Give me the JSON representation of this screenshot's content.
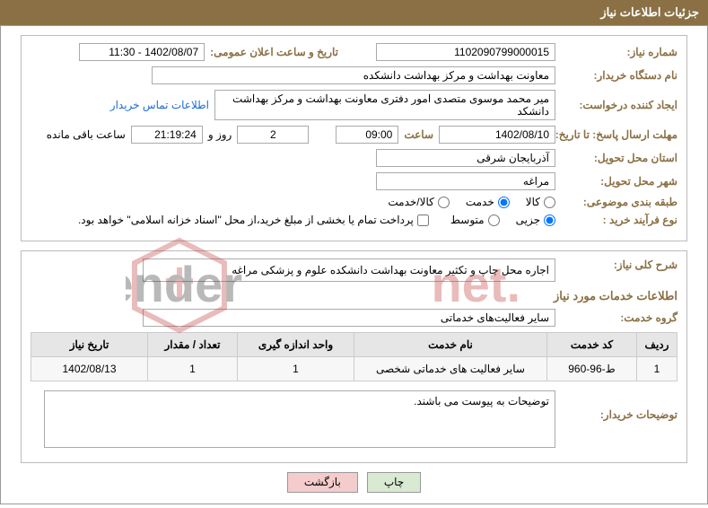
{
  "header": {
    "title": "جزئیات اطلاعات نیاز"
  },
  "fields": {
    "need_no_label": "شماره نیاز:",
    "need_no": "1102090799000015",
    "pub_date_label": "تاریخ و ساعت اعلان عمومی:",
    "pub_date": "1402/08/07 - 11:30",
    "buyer_org_label": "نام دستگاه خریدار:",
    "buyer_org": "معاونت بهداشت و مرکز بهداشت دانشکده",
    "requester_label": "ایجاد کننده درخواست:",
    "requester": "میر محمد موسوی متصدی امور دفتری معاونت بهداشت و مرکز بهداشت دانشکد",
    "contact_link": "اطلاعات تماس خریدار",
    "deadline_label": "مهلت ارسال پاسخ: تا تاریخ:",
    "deadline_date": "1402/08/10",
    "time_label": "ساعت",
    "deadline_time": "09:00",
    "days_count": "2",
    "days_and": "روز و",
    "remaining_time": "21:19:24",
    "remaining_label": "ساعت باقی مانده",
    "province_label": "استان محل تحویل:",
    "province": "آذربایجان شرقی",
    "city_label": "شهر محل تحویل:",
    "city": "مراغه",
    "subject_class_label": "طبقه بندی موضوعی:",
    "opt_goods": "کالا",
    "opt_service": "خدمت",
    "opt_goods_service": "کالا/خدمت",
    "process_label": "نوع فرآیند خرید :",
    "opt_minor": "جزیی",
    "opt_moderate": "متوسط",
    "payment_note": "پرداخت تمام یا بخشی از مبلغ خرید،از محل \"اسناد خزانه اسلامی\" خواهد بود.",
    "overview_label": "شرح کلی نیاز:",
    "overview": "اجاره محل چاپ و تکثیر معاونت بهداشت دانشکده علوم و پزشکی مراغه",
    "services_title": "اطلاعات خدمات مورد نیاز",
    "service_group_label": "گروه خدمت:",
    "service_group": "سایر فعالیت‌های خدماتی",
    "explain_label": "توضیحات خریدار:",
    "explain_text": "توضیحات به پیوست می باشند."
  },
  "table": {
    "headers": {
      "row": "ردیف",
      "code": "کد خدمت",
      "name": "نام خدمت",
      "unit": "واحد اندازه گیری",
      "qty": "تعداد / مقدار",
      "date": "تاریخ نیاز"
    },
    "rows": [
      {
        "row": "1",
        "code": "ط-96-960",
        "name": "سایر فعالیت های خدماتی شخصی",
        "unit": "1",
        "qty": "1",
        "date": "1402/08/13"
      }
    ]
  },
  "buttons": {
    "print": "چاپ",
    "back": "بازگشت"
  }
}
